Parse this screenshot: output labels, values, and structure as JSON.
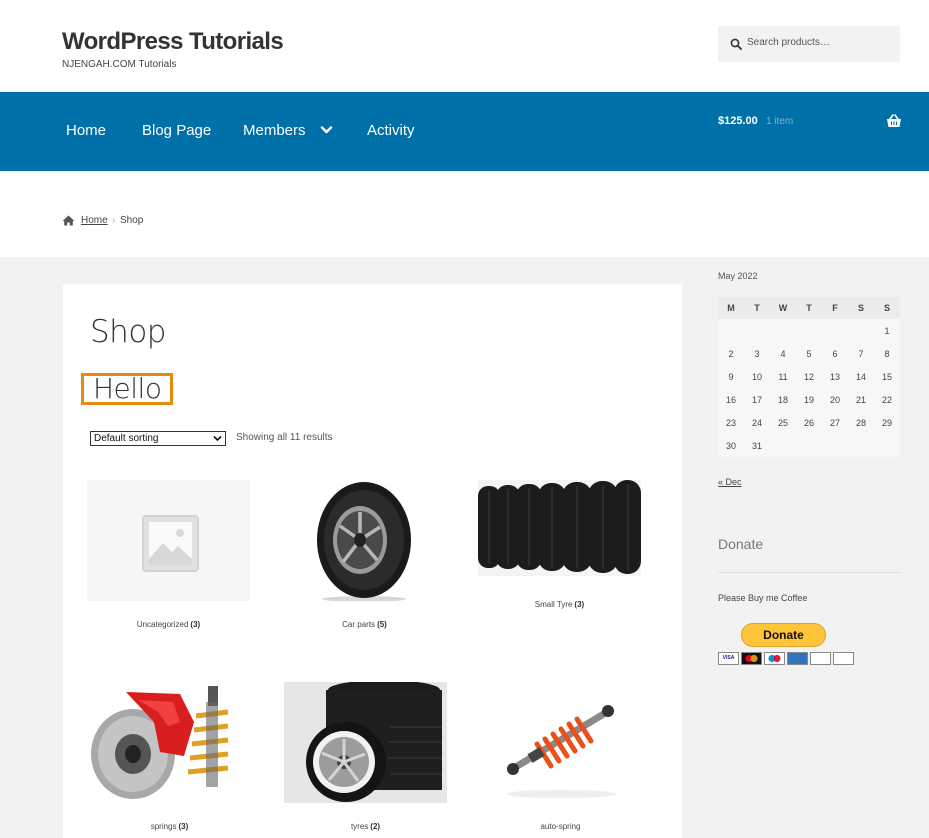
{
  "header": {
    "site_title": "WordPress Tutorials",
    "tagline": "NJENGAH.COM Tutorials",
    "search_placeholder": "Search products…"
  },
  "nav": {
    "items": [
      {
        "label": "Home"
      },
      {
        "label": "Blog Page"
      },
      {
        "label": "Members"
      },
      {
        "label": "Activity"
      }
    ],
    "cart_amount": "$125.00",
    "cart_count": "1 item"
  },
  "breadcrumb": {
    "home": "Home",
    "separator": "›",
    "current": "Shop"
  },
  "main": {
    "page_title": "Shop",
    "hello_heading": "Hello",
    "sort_selected": "Default sorting",
    "result_count": "Showing all 11 results",
    "categories": [
      {
        "name": "Uncategorized",
        "count": "(3)"
      },
      {
        "name": "Car parts",
        "count": "(5)"
      },
      {
        "name": "Small Tyre",
        "count": "(3)"
      },
      {
        "name": "springs",
        "count": "(3)"
      },
      {
        "name": "tyres",
        "count": "(2)"
      },
      {
        "name": "auto-spring",
        "count": ""
      }
    ]
  },
  "sidebar": {
    "calendar": {
      "caption": "May 2022",
      "weekdays": [
        "M",
        "T",
        "W",
        "T",
        "F",
        "S",
        "S"
      ],
      "weeks": [
        [
          "",
          "",
          "",
          "",
          "",
          "",
          "1"
        ],
        [
          "2",
          "3",
          "4",
          "5",
          "6",
          "7",
          "8"
        ],
        [
          "9",
          "10",
          "11",
          "12",
          "13",
          "14",
          "15"
        ],
        [
          "16",
          "17",
          "18",
          "19",
          "20",
          "21",
          "22"
        ],
        [
          "23",
          "24",
          "25",
          "26",
          "27",
          "28",
          "29"
        ],
        [
          "30",
          "31",
          "",
          "",
          "",
          "",
          ""
        ]
      ],
      "prev_link": "« Dec"
    },
    "donate": {
      "title": "Donate",
      "text": "Please Buy me Coffee",
      "button_label": "Donate",
      "cards": [
        "VISA",
        "MC",
        "Maestro",
        "AMEX",
        "DISCOVER",
        "JCB"
      ]
    }
  },
  "colors": {
    "nav_bg": "#0070a8",
    "highlight_border": "#e78a14",
    "content_bg": "#f2f2f2",
    "donate_button": "#ffc439"
  }
}
